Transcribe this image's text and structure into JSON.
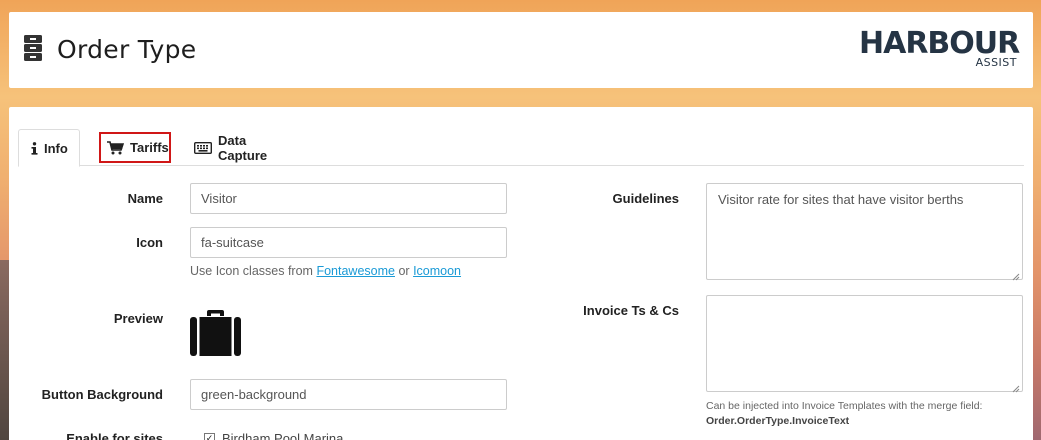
{
  "header": {
    "title": "Order Type",
    "logo_brand": "HARBOUR",
    "logo_sub": "ASSIST"
  },
  "tabs": [
    {
      "label": "Info",
      "icon": "info-icon",
      "active": true
    },
    {
      "label": "Tariffs",
      "icon": "cart-icon",
      "active": false,
      "highlighted": true
    },
    {
      "label": "Data Capture",
      "icon": "keyboard-icon",
      "active": false
    }
  ],
  "form": {
    "name_label": "Name",
    "name_value": "Visitor",
    "icon_label": "Icon",
    "icon_value": "fa-suitcase",
    "icon_help_prefix": "Use Icon classes from",
    "icon_help_link1": "Fontawesome",
    "icon_help_or": "or",
    "icon_help_link2": "Icomoon",
    "preview_label": "Preview",
    "preview_icon": "suitcase-icon",
    "button_bg_label": "Button Background",
    "button_bg_value": "green-background",
    "enable_sites_label": "Enable for sites",
    "site_option": "Birdham Pool Marina",
    "site_checked": true,
    "guidelines_label": "Guidelines",
    "guidelines_value": "Visitor rate for sites that have visitor berths",
    "invoice_label": "Invoice Ts & Cs",
    "invoice_value": "",
    "invoice_note_line1": "Can be injected into Invoice Templates with the merge field:",
    "invoice_note_field": "Order.OrderType.InvoiceText"
  },
  "colors": {
    "highlight": "#d01717",
    "link": "#1a9ad6",
    "brand": "#253444"
  }
}
